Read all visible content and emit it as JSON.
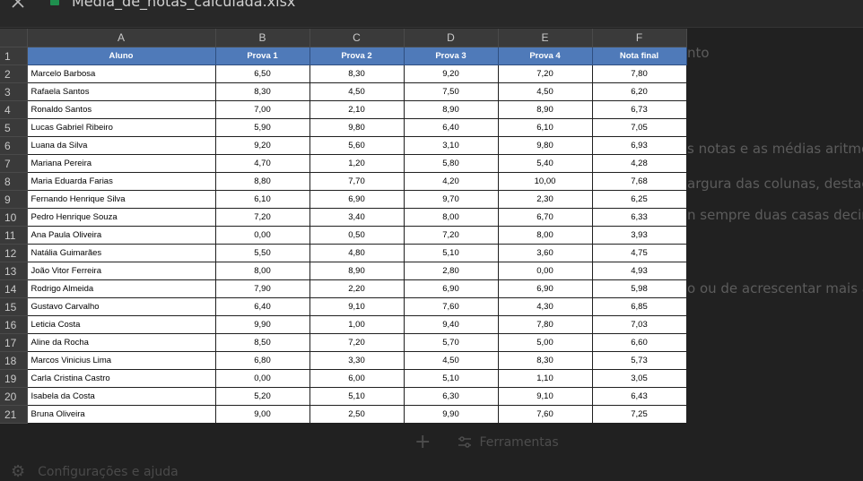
{
  "window": {
    "title": "Media_de_notas_calculada.xlsx"
  },
  "background_text": [
    "nto",
    "s notas e as médias aritmé",
    "argura das colunas, destac",
    "n sempre duas casas decim",
    "o ou de acrescentar mais a"
  ],
  "bottom_bar": {
    "plus_label": "+",
    "tools_label": "Ferramentas"
  },
  "settings": {
    "label": "Configurações e ajuda"
  },
  "sheet": {
    "columns": [
      "A",
      "B",
      "C",
      "D",
      "E",
      "F"
    ],
    "header_row_number": "1",
    "header": [
      "Aluno",
      "Prova 1",
      "Prova 2",
      "Prova 3",
      "Prova 4",
      "Nota final"
    ],
    "rows": [
      {
        "num": "2",
        "cells": [
          "Marcelo Barbosa",
          "6,50",
          "8,30",
          "9,20",
          "7,20",
          "7,80"
        ]
      },
      {
        "num": "3",
        "cells": [
          "Rafaela Santos",
          "8,30",
          "4,50",
          "7,50",
          "4,50",
          "6,20"
        ]
      },
      {
        "num": "4",
        "cells": [
          "Ronaldo Santos",
          "7,00",
          "2,10",
          "8,90",
          "8,90",
          "6,73"
        ]
      },
      {
        "num": "5",
        "cells": [
          "Lucas Gabriel Ribeiro",
          "5,90",
          "9,80",
          "6,40",
          "6,10",
          "7,05"
        ]
      },
      {
        "num": "6",
        "cells": [
          "Luana da Silva",
          "9,20",
          "5,60",
          "3,10",
          "9,80",
          "6,93"
        ]
      },
      {
        "num": "7",
        "cells": [
          "Mariana Pereira",
          "4,70",
          "1,20",
          "5,80",
          "5,40",
          "4,28"
        ]
      },
      {
        "num": "8",
        "cells": [
          "Maria Eduarda Farias",
          "8,80",
          "7,70",
          "4,20",
          "10,00",
          "7,68"
        ]
      },
      {
        "num": "9",
        "cells": [
          "Fernando Henrique Silva",
          "6,10",
          "6,90",
          "9,70",
          "2,30",
          "6,25"
        ]
      },
      {
        "num": "10",
        "cells": [
          "Pedro Henrique Souza",
          "7,20",
          "3,40",
          "8,00",
          "6,70",
          "6,33"
        ]
      },
      {
        "num": "11",
        "cells": [
          "Ana Paula Oliveira",
          "0,00",
          "0,50",
          "7,20",
          "8,00",
          "3,93"
        ]
      },
      {
        "num": "12",
        "cells": [
          "Natália Guimarães",
          "5,50",
          "4,80",
          "5,10",
          "3,60",
          "4,75"
        ]
      },
      {
        "num": "13",
        "cells": [
          "João Vitor Ferreira",
          "8,00",
          "8,90",
          "2,80",
          "0,00",
          "4,93"
        ]
      },
      {
        "num": "14",
        "cells": [
          "Rodrigo Almeida",
          "7,90",
          "2,20",
          "6,90",
          "6,90",
          "5,98"
        ]
      },
      {
        "num": "15",
        "cells": [
          "Gustavo Carvalho",
          "6,40",
          "9,10",
          "7,60",
          "4,30",
          "6,85"
        ]
      },
      {
        "num": "16",
        "cells": [
          "Leticia Costa",
          "9,90",
          "1,00",
          "9,40",
          "7,80",
          "7,03"
        ]
      },
      {
        "num": "17",
        "cells": [
          "Aline da Rocha",
          "8,50",
          "7,20",
          "5,70",
          "5,00",
          "6,60"
        ]
      },
      {
        "num": "18",
        "cells": [
          "Marcos Vinicius Lima",
          "6,80",
          "3,30",
          "4,50",
          "8,30",
          "5,73"
        ]
      },
      {
        "num": "19",
        "cells": [
          "Carla Cristina Castro",
          "0,00",
          "6,00",
          "5,10",
          "1,10",
          "3,05"
        ]
      },
      {
        "num": "20",
        "cells": [
          "Isabela da Costa",
          "5,20",
          "5,10",
          "6,30",
          "9,10",
          "6,43"
        ]
      },
      {
        "num": "21",
        "cells": [
          "Bruna Oliveira",
          "9,00",
          "2,50",
          "9,90",
          "7,60",
          "7,25"
        ]
      }
    ]
  },
  "icons": {
    "close": "close-icon",
    "file": "spreadsheet-file-icon",
    "tools": "sliders-icon",
    "settings": "gear-icon"
  },
  "colors": {
    "background": "#212121",
    "header_fill": "#4f7ab9",
    "cell_fill": "#ffffff",
    "file_icon": "#1f8f4e"
  }
}
